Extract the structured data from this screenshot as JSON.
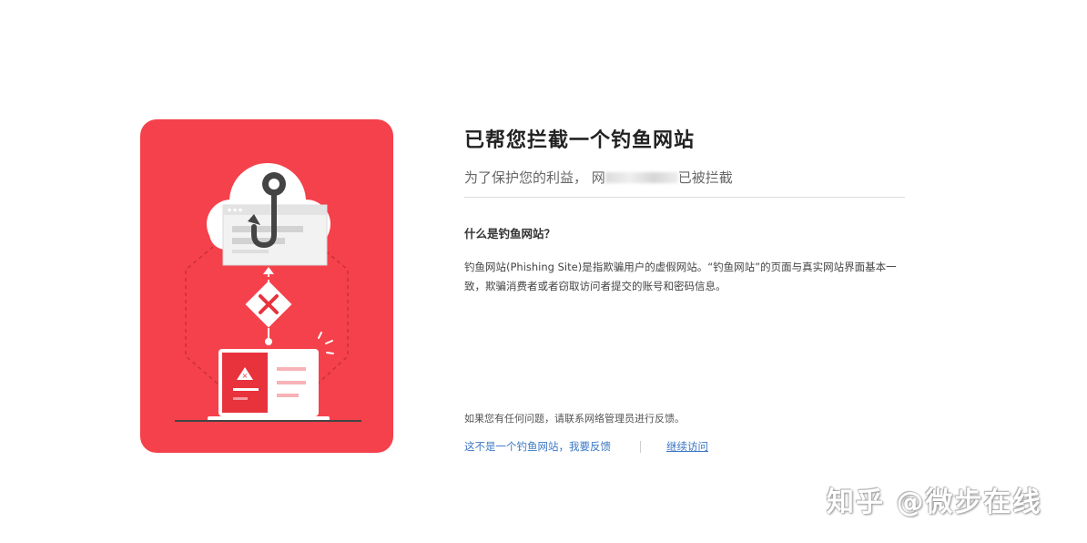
{
  "illustration": {
    "card_color": "#f5414b"
  },
  "main": {
    "title": "已帮您拦截一个钓鱼网站",
    "subtitle_prefix": "为了保护您的利益， 网",
    "subtitle_suffix": "已被拦截",
    "question": "什么是钓鱼网站？",
    "explanation": "钓鱼网站(Phishing Site)是指欺骗用户的虚假网站。“钓鱼网站”的页面与真实网站界面基本一致，欺骗消费者或者窃取访问者提交的账号和密码信息。"
  },
  "footer": {
    "help_text": "如果您有任何问题，请联系网络管理员进行反馈。",
    "report_link": "这不是一个钓鱼网站，我要反馈",
    "continue_link": "继续访问"
  },
  "watermark": {
    "text": "知乎 @微步在线"
  },
  "colors": {
    "accent": "#f5414b",
    "link": "#3b77c4"
  }
}
